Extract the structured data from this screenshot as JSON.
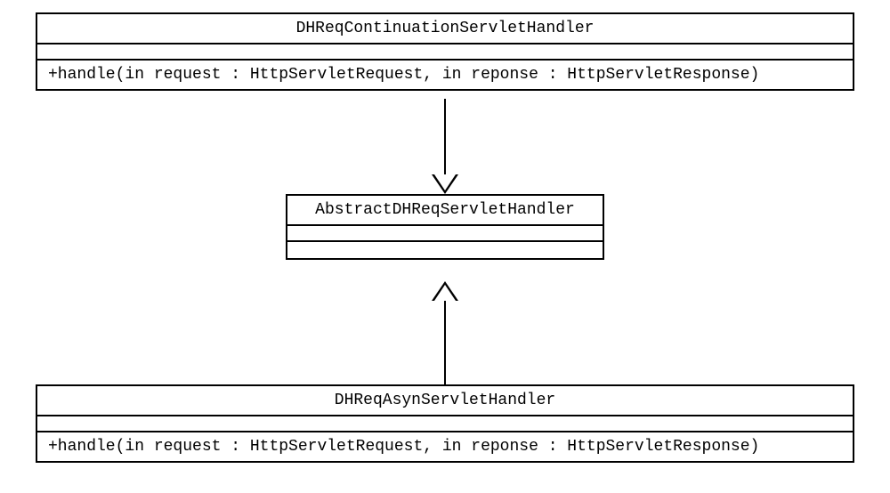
{
  "classes": {
    "top": {
      "name": "DHReqContinuationServletHandler",
      "operation": "+handle(in request : HttpServletRequest, in reponse : HttpServletResponse)"
    },
    "middle": {
      "name": "AbstractDHReqServletHandler"
    },
    "bottom": {
      "name": "DHReqAsynServletHandler",
      "operation": "+handle(in request : HttpServletRequest, in reponse : HttpServletResponse)"
    }
  }
}
